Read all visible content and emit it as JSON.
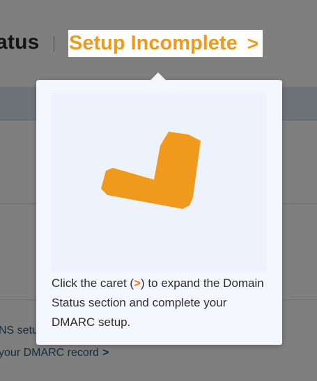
{
  "header": {
    "title_partial": "atus",
    "setup_link": {
      "label": "Setup Incomplete",
      "caret": ">"
    }
  },
  "body": {
    "ns_setup_partial": "NS setu",
    "dmarc_link": {
      "label": "your DMARC record",
      "caret": ">"
    }
  },
  "popover": {
    "text_before": "Click the caret (",
    "caret_symbol": ">",
    "text_after": ") to expand the Domain Status section and complete your DMARC setup.",
    "illustration_icon": "checkmark-icon"
  },
  "colors": {
    "accent": "#ef9a1c",
    "link": "#2b5a84",
    "popover_bg": "#f3f6fc"
  }
}
